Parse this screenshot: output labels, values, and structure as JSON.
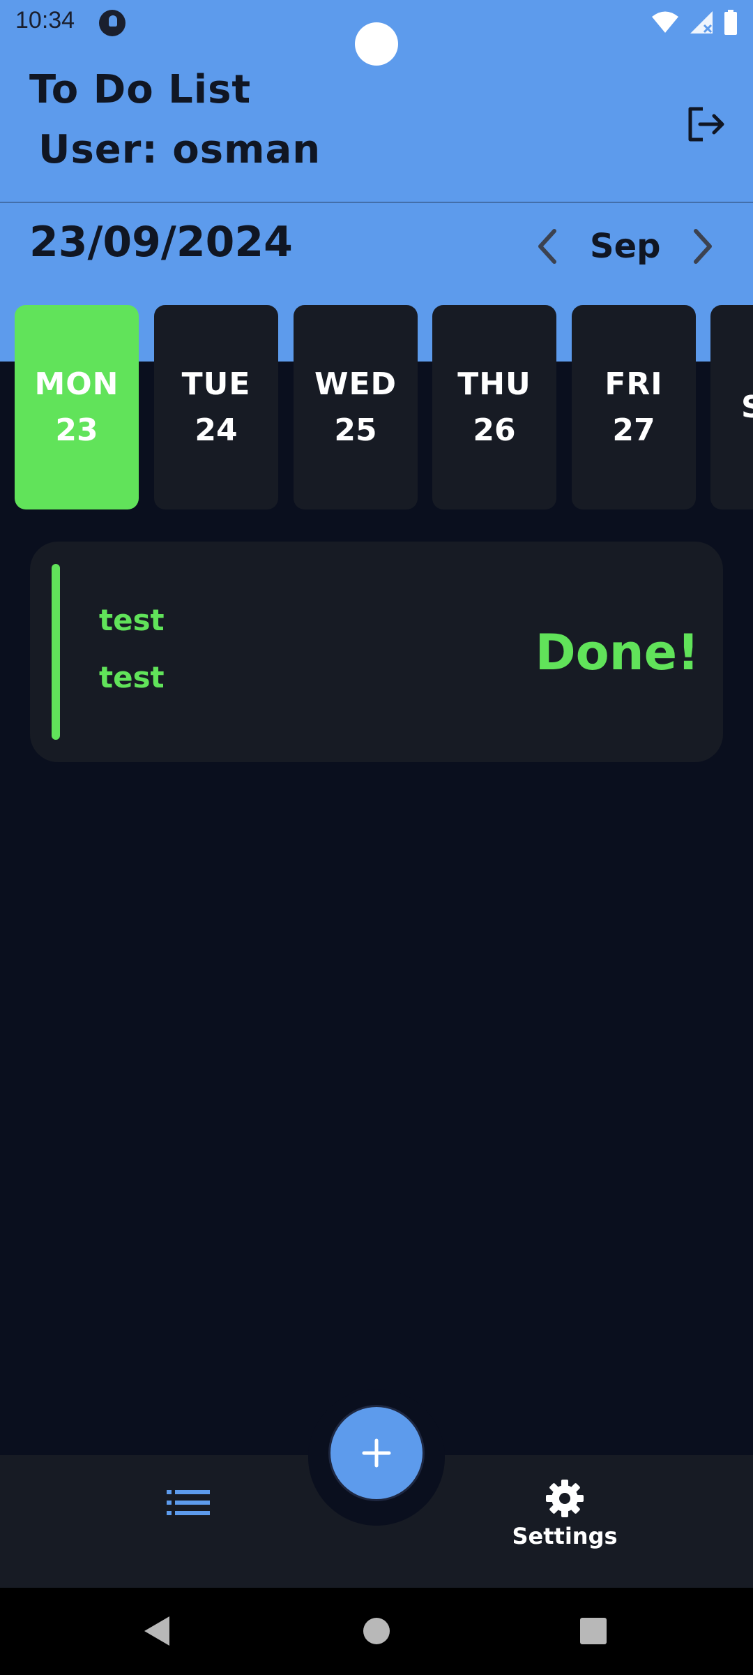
{
  "status_bar": {
    "time": "10:34"
  },
  "header": {
    "title": "To Do List",
    "user_label": "User: osman",
    "date": "23/09/2024",
    "month": "Sep"
  },
  "days": [
    {
      "name": "MON",
      "num": "23",
      "selected": true
    },
    {
      "name": "TUE",
      "num": "24",
      "selected": false
    },
    {
      "name": "WED",
      "num": "25",
      "selected": false
    },
    {
      "name": "THU",
      "num": "26",
      "selected": false
    },
    {
      "name": "FRI",
      "num": "27",
      "selected": false
    },
    {
      "name": "S",
      "num": "",
      "selected": false
    }
  ],
  "tasks": [
    {
      "title": "test",
      "description": "test",
      "status": "Done!"
    }
  ],
  "bottom_nav": {
    "settings_label": "Settings"
  },
  "colors": {
    "header_bg": "#5d9bec",
    "page_bg": "#0a0f1e",
    "card_bg": "#171b24",
    "accent_green": "#61e35a"
  },
  "icons": [
    "logout-icon",
    "chevron-left-icon",
    "chevron-right-icon",
    "list-icon",
    "gear-icon",
    "plus-icon",
    "back-icon",
    "home-icon",
    "recents-icon"
  ]
}
